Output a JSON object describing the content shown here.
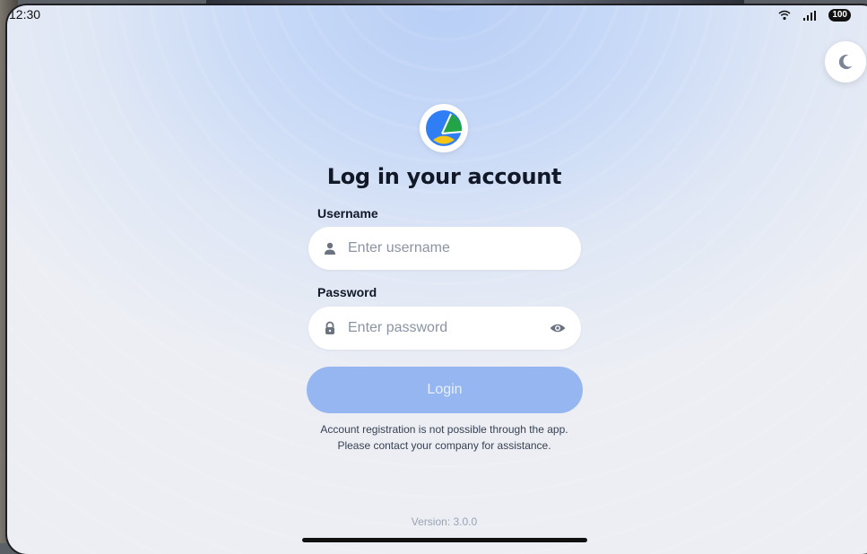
{
  "status_bar": {
    "time": "12:30",
    "battery": "100",
    "icons": [
      "wifi-icon",
      "signal-icon"
    ]
  },
  "theme_toggle": {
    "icon": "moon-icon"
  },
  "logo": {
    "icon": "app-logo-icon"
  },
  "title": "Log in your account",
  "username": {
    "label": "Username",
    "placeholder": "Enter username",
    "value": "",
    "icon": "user-icon"
  },
  "password": {
    "label": "Password",
    "placeholder": "Enter password",
    "value": "",
    "icon": "lock-icon",
    "toggle_icon": "eye-icon"
  },
  "login_button": {
    "label": "Login"
  },
  "notice": {
    "line1": "Account registration is not possible through the app.",
    "line2": "Please contact your company for assistance."
  },
  "version": "Version: 3.0.0",
  "colors": {
    "accent": "#95b6f0",
    "title": "#111827",
    "placeholder": "#8a94a3",
    "logo_blue": "#2f7ef5",
    "logo_green": "#22a447",
    "logo_yellow": "#f5c518"
  }
}
